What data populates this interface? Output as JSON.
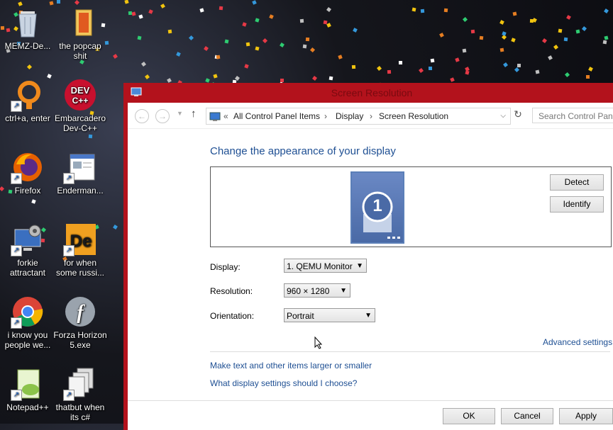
{
  "desktop": {
    "icons": [
      {
        "label": "MEMZ-De...",
        "icon": "recycle-bin-icon"
      },
      {
        "label": "the popcap shit",
        "icon": "folder-icon"
      },
      {
        "label": "ctrl+a, enter",
        "icon": "orange-ring-icon"
      },
      {
        "label": "Embarcadero Dev-C++",
        "icon": "devcpp-icon"
      },
      {
        "label": "Firefox",
        "icon": "firefox-icon"
      },
      {
        "label": "Enderman...",
        "icon": "shortcut-window-icon"
      },
      {
        "label": "forkie attractant",
        "icon": "gear-monitor-icon"
      },
      {
        "label": "for when some russi...",
        "icon": "de-icon"
      },
      {
        "label": "i know you people we...",
        "icon": "chrome-icon"
      },
      {
        "label": "Forza Horizon 5.exe",
        "icon": "flash-icon"
      },
      {
        "label": "Notepad++",
        "icon": "notepadpp-icon"
      },
      {
        "label": "thatbut when its c#",
        "icon": "stacked-windows-icon"
      }
    ],
    "colors": {
      "window_frame": "#b3121c",
      "link": "#1e4f93"
    }
  },
  "window": {
    "title": "Screen Resolution",
    "address": {
      "crumbs": [
        "All Control Panel Items",
        "Display",
        "Screen Resolution"
      ],
      "overflow": "«"
    },
    "search_placeholder": "Search Control Panel",
    "heading": "Change the appearance of your display",
    "monitor_number": "1",
    "detect_label": "Detect",
    "identify_label": "Identify",
    "display_label": "Display:",
    "display_value": "1. QEMU Monitor",
    "resolution_label": "Resolution:",
    "resolution_value": "960 × 1280",
    "orientation_label": "Orientation:",
    "orientation_value": "Portrait",
    "advanced_link": "Advanced settings",
    "link_larger": "Make text and other items larger or smaller",
    "link_choose": "What display settings should I choose?",
    "ok_label": "OK",
    "cancel_label": "Cancel",
    "apply_label": "Apply"
  }
}
